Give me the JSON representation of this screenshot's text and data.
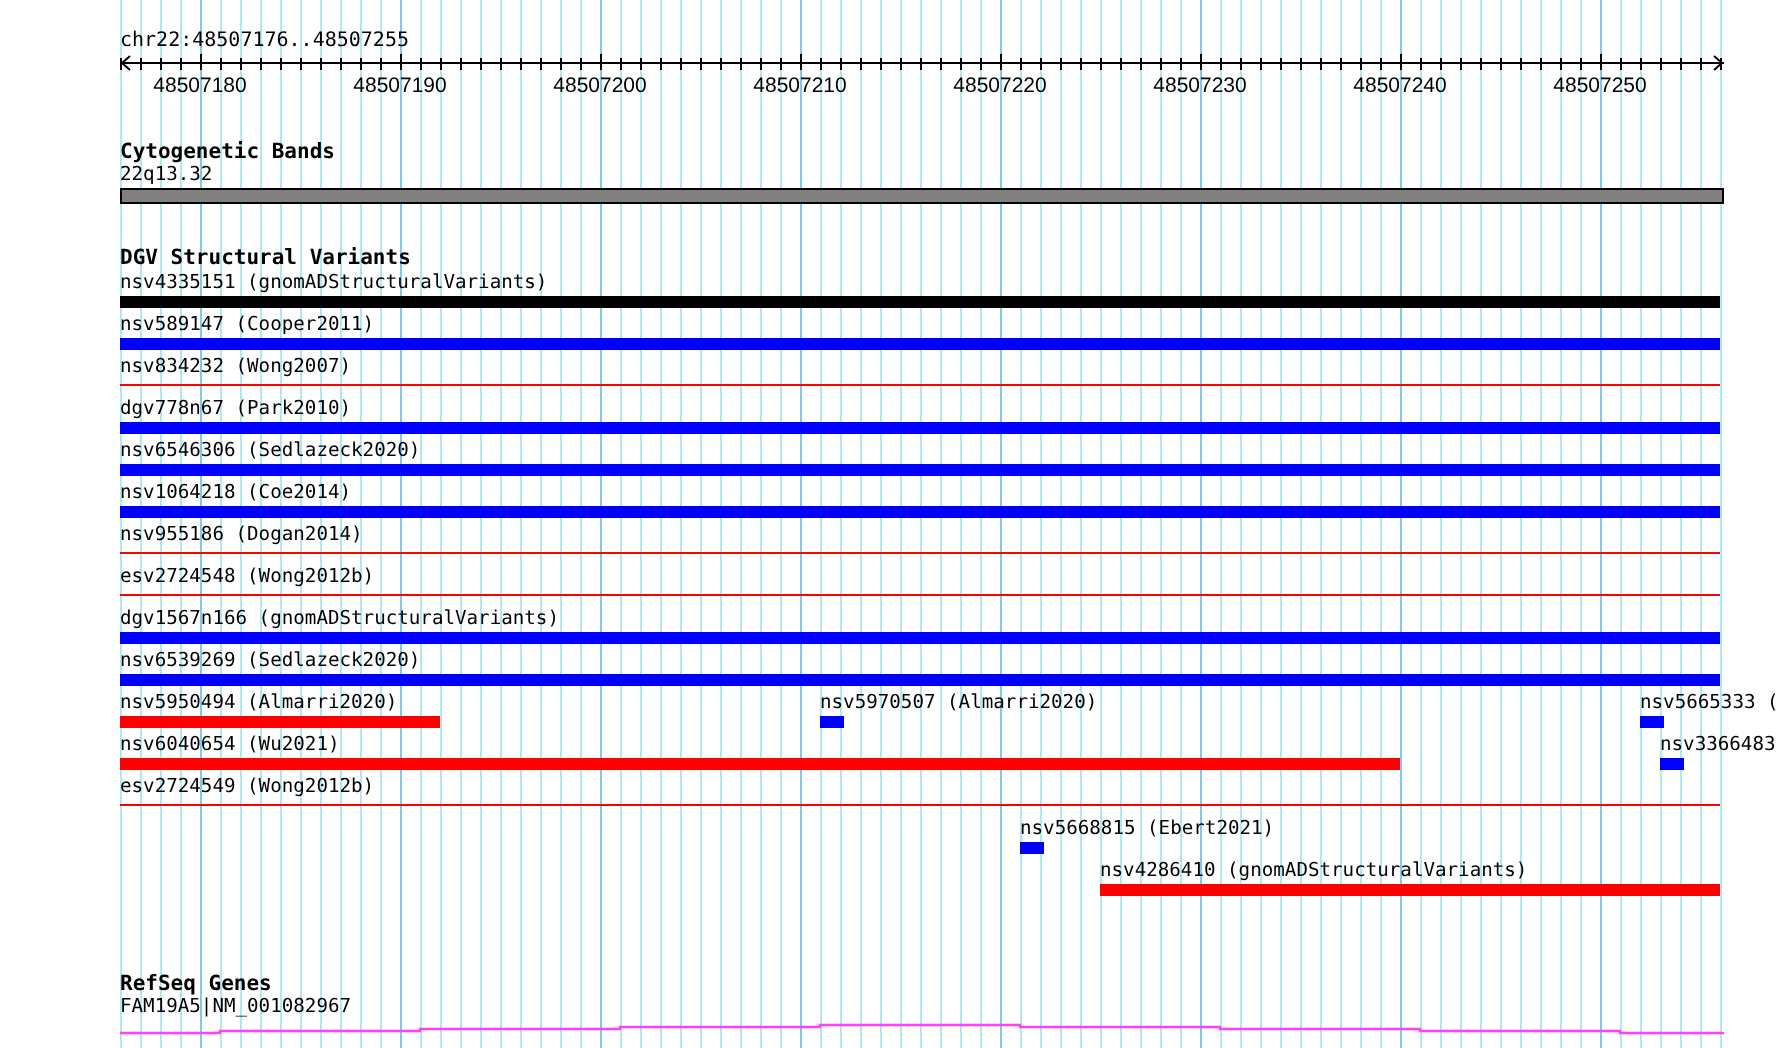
{
  "location": "chr22:48507176..48507255",
  "ruler": {
    "ticks": [
      "48507180",
      "48507190",
      "48507200",
      "48507210",
      "48507220",
      "48507230",
      "48507240",
      "48507250"
    ]
  },
  "cytogenetic_bands": {
    "title": "Cytogenetic Bands",
    "features": [
      {
        "label": "22q13.32"
      }
    ]
  },
  "dgv_structural_variants": {
    "title": "DGV Structural Variants",
    "features": [
      {
        "label": "nsv4335151 (gnomADStructuralVariants)",
        "kind": "bar",
        "color": "#000000"
      },
      {
        "label": "nsv589147 (Cooper2011)",
        "kind": "bar",
        "color": "#0000ff"
      },
      {
        "label": "nsv834232 (Wong2007)",
        "kind": "line",
        "color": "#ff0000"
      },
      {
        "label": "dgv778n67 (Park2010)",
        "kind": "bar",
        "color": "#0000ff"
      },
      {
        "label": "nsv6546306 (Sedlazeck2020)",
        "kind": "bar",
        "color": "#0000ff"
      },
      {
        "label": "nsv1064218 (Coe2014)",
        "kind": "bar",
        "color": "#0000ff"
      },
      {
        "label": "nsv955186 (Dogan2014)",
        "kind": "line",
        "color": "#ff0000"
      },
      {
        "label": "esv2724548 (Wong2012b)",
        "kind": "line",
        "color": "#ff0000"
      },
      {
        "label": "dgv1567n166 (gnomADStructuralVariants)",
        "kind": "bar",
        "color": "#0000ff"
      },
      {
        "label": "nsv6539269 (Sedlazeck2020)",
        "kind": "bar",
        "color": "#0000ff"
      },
      {
        "label": "nsv5950494 (Almarri2020)",
        "kind": "bar",
        "color": "#ff0000"
      },
      {
        "label": "nsv5970507 (Almarri2020)",
        "kind": "bar",
        "color": "#0000ff"
      },
      {
        "label": "nsv5665333 (",
        "kind": "bar",
        "color": "#0000ff"
      },
      {
        "label": "nsv6040654 (Wu2021)",
        "kind": "bar",
        "color": "#ff0000"
      },
      {
        "label": "nsv3366483",
        "kind": "bar",
        "color": "#0000ff"
      },
      {
        "label": "esv2724549 (Wong2012b)",
        "kind": "line",
        "color": "#ff0000"
      },
      {
        "label": "nsv5668815 (Ebert2021)",
        "kind": "bar",
        "color": "#0000ff"
      },
      {
        "label": "nsv4286410 (gnomADStructuralVariants)",
        "kind": "bar",
        "color": "#ff0000"
      }
    ]
  },
  "refseq_genes": {
    "title": "RefSeq Genes",
    "features": [
      {
        "label": "FAM19A5|NM_001082967"
      }
    ]
  }
}
